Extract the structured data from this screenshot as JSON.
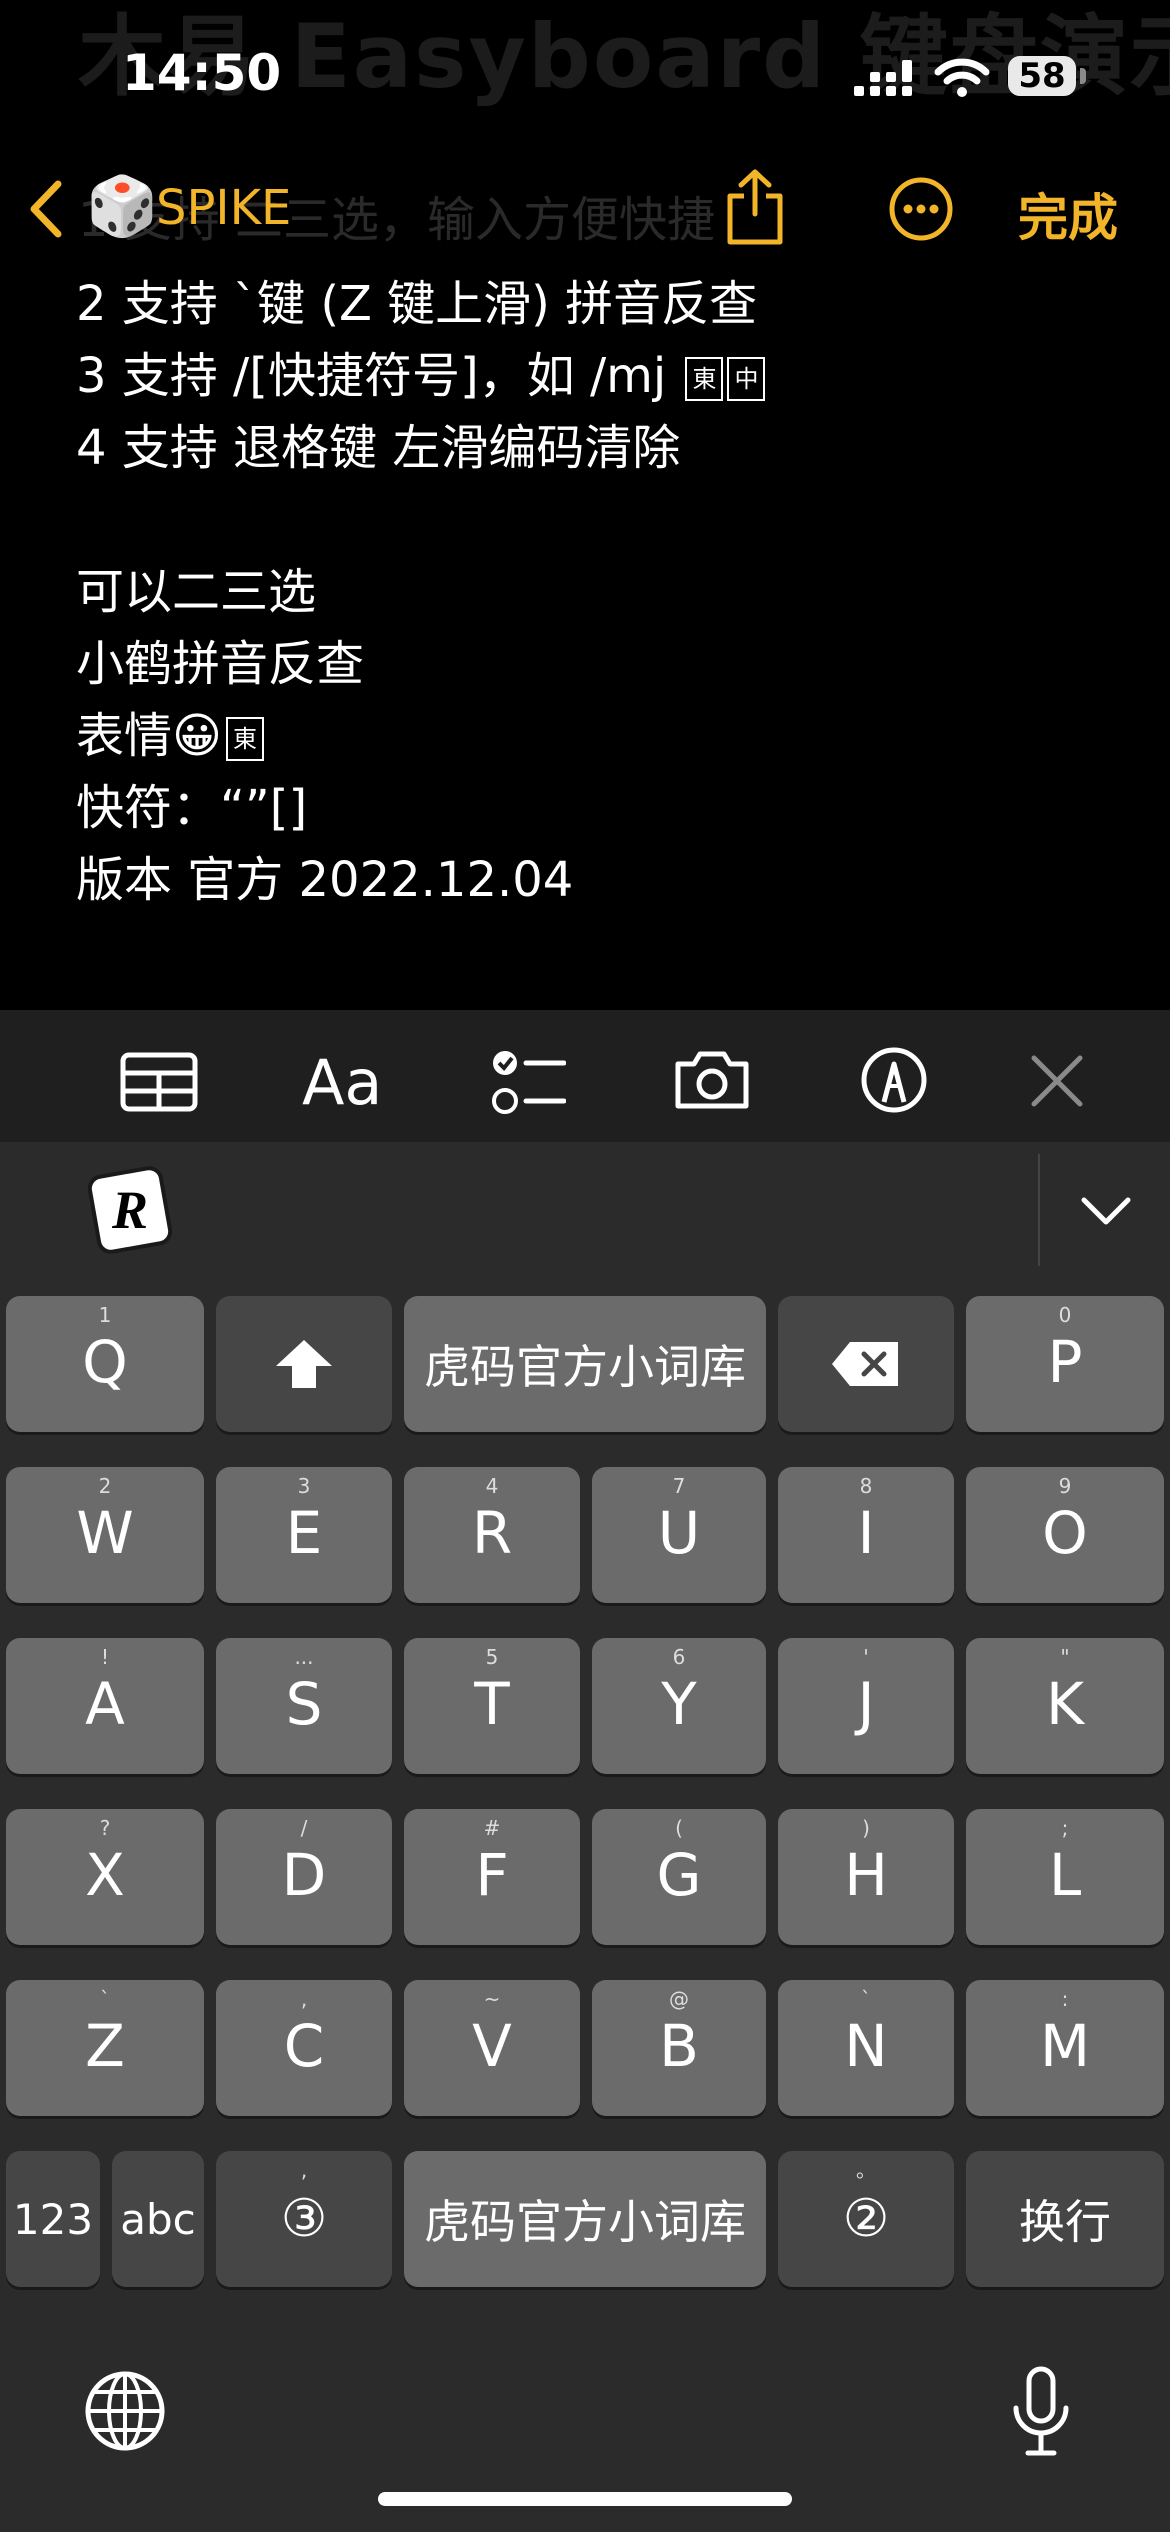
{
  "status_bar": {
    "time": "14:50",
    "battery": "58"
  },
  "background_note": {
    "title": "木易 Easyboard 键盘演示",
    "first_line": "1 支持 二三选，输入方便快捷"
  },
  "nav": {
    "back_label": "SPIKE",
    "back_emoji": "🎲",
    "done_label": "完成"
  },
  "note_lines": [
    {
      "text": "2 支持 `键 (Z 键上滑) 拼音反查"
    },
    {
      "text": "3 支持 /[快捷符号]，如 /mj ",
      "glyphs": [
        "東",
        "中"
      ]
    },
    {
      "text": "4 支持 退格键 左滑编码清除"
    },
    {
      "text": ""
    },
    {
      "text": "可以二三选"
    },
    {
      "text": "小鹤拼音反查"
    },
    {
      "text": "表情😀",
      "glyphs": [
        "東"
      ]
    },
    {
      "text": "快符：“”[]"
    },
    {
      "text": "版本 官方 2022.12.04"
    }
  ],
  "toolbar": {
    "items": [
      "table-icon",
      "Aa",
      "checklist-icon",
      "camera-icon",
      "markup-icon",
      "close-icon"
    ],
    "format_label": "Aa"
  },
  "keyboard": {
    "logo_letter": "R",
    "rows": [
      [
        {
          "main": "Q",
          "sub": "1"
        },
        {
          "icon": "shift"
        },
        {
          "text": "虎码官方小词库"
        },
        {
          "icon": "delete"
        },
        {
          "main": "P",
          "sub": "0"
        }
      ],
      [
        {
          "main": "W",
          "sub": "2"
        },
        {
          "main": "E",
          "sub": "3"
        },
        {
          "main": "R",
          "sub": "4"
        },
        {
          "main": "U",
          "sub": "7"
        },
        {
          "main": "I",
          "sub": "8"
        },
        {
          "main": "O",
          "sub": "9"
        }
      ],
      [
        {
          "main": "A",
          "sub": "!"
        },
        {
          "main": "S",
          "sub": "..."
        },
        {
          "main": "T",
          "sub": "5"
        },
        {
          "main": "Y",
          "sub": "6"
        },
        {
          "main": "J",
          "sub": "'"
        },
        {
          "main": "K",
          "sub": "\""
        }
      ],
      [
        {
          "main": "X",
          "sub": "?"
        },
        {
          "main": "D",
          "sub": "/"
        },
        {
          "main": "F",
          "sub": "#"
        },
        {
          "main": "G",
          "sub": "("
        },
        {
          "main": "H",
          "sub": ")"
        },
        {
          "main": "L",
          "sub": ";"
        }
      ],
      [
        {
          "main": "Z",
          "sub": "`"
        },
        {
          "main": "C",
          "sub": ","
        },
        {
          "main": "V",
          "sub": "~"
        },
        {
          "main": "B",
          "sub": "@"
        },
        {
          "main": "N",
          "sub": "`"
        },
        {
          "main": "M",
          "sub": ":"
        }
      ],
      [
        {
          "text": "123"
        },
        {
          "text": "abc"
        },
        {
          "text": "③",
          "sub": ","
        },
        {
          "text": "虎码官方小词库"
        },
        {
          "text": "②",
          "sub": "。"
        },
        {
          "text": "换行"
        }
      ]
    ]
  }
}
